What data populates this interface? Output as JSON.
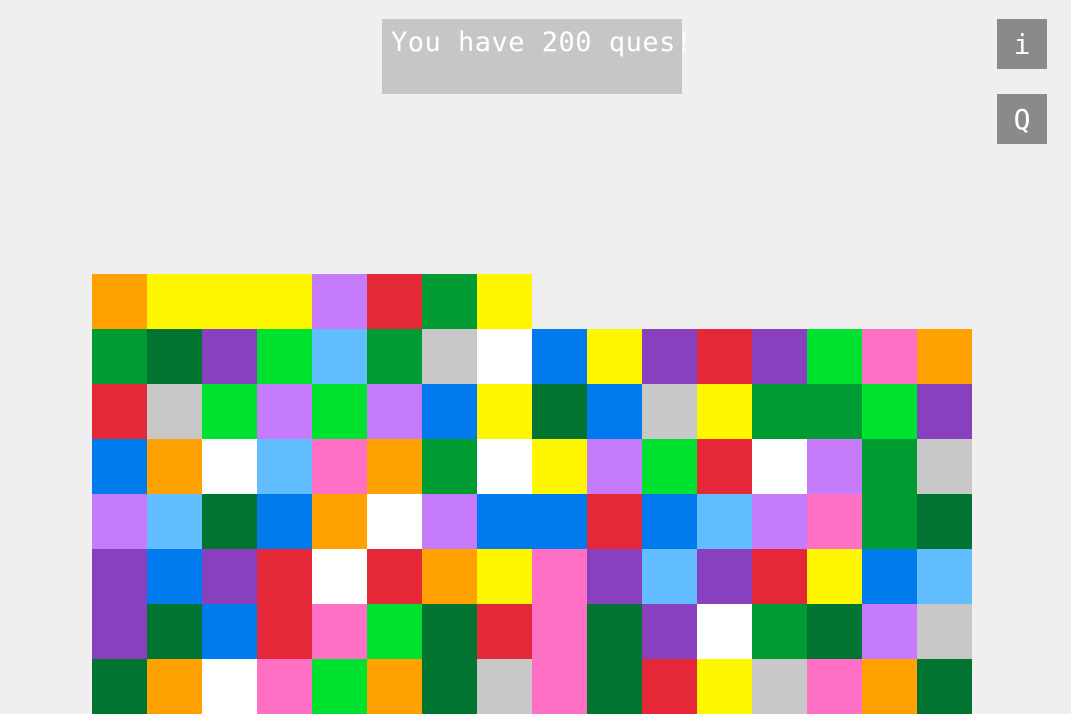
{
  "message": "You have 200 ques!",
  "buttons": {
    "info_label": "i",
    "quit_label": "Q"
  },
  "palette": {
    "O": "#ffa100",
    "Y": "#fff700",
    "L": "#c67bfb",
    "R": "#e52838",
    "G": "#009c33",
    "D": "#007430",
    "P": "#8840be",
    "B": "#00e230",
    "S": "#62bdff",
    "C": "#c8c8c8",
    "W": "#ffffff",
    "U": "#007bee",
    "K": "#ff6fc3"
  },
  "board_rows": [
    "OYYYLRGY........",
    "GDPBSGCWUYPRPBKO",
    "RCBLBLUYDUCYGGBP",
    "UOWSKOGWYLBRWLGC",
    "LSDUOWLUURUSLKGD",
    "PUPRWROYKPSPRYUS",
    "PDURKBDRKDPWGDLC",
    "DOWKBODCKDRYCKOD"
  ]
}
